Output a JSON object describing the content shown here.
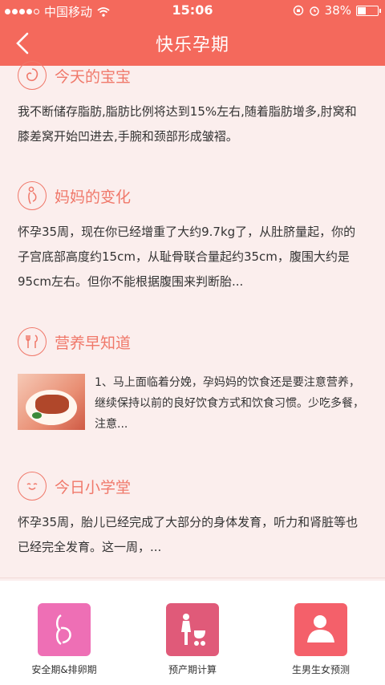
{
  "status": {
    "carrier": "中国移动",
    "time": "15:06",
    "battery": "38%"
  },
  "nav": {
    "title": "快乐孕期"
  },
  "sections": {
    "baby": {
      "title": "今天的宝宝",
      "text": "我不断储存脂肪,脂肪比例将达到15%左右,随着脂肪增多,肘窝和膝差窝开始凹进去,手腕和颈部形成皱褶。"
    },
    "mother": {
      "title": "妈妈的变化",
      "text": "怀孕35周，现在你已经增重了大约9.7kg了，从肚脐量起，你的子宫底部高度约15cm，从耻骨联合量起约35cm，腹围大约是95cm左右。但你不能根据腹围来判断胎..."
    },
    "nutrition": {
      "title": "营养早知道",
      "text": "1、马上面临着分娩，孕妈妈的饮食还是要注意营养，继续保持以前的良好饮食方式和饮食习惯。少吃多餐，注意..."
    },
    "school": {
      "title": "今日小学堂",
      "text": "怀孕35周，胎儿已经完成了大部分的身体发育，听力和肾脏等也已经完全发育。这一周，..."
    }
  },
  "tabs": [
    {
      "label": "安全期&排卵期",
      "color": "#ee6fb5"
    },
    {
      "label": "预产期计算",
      "color": "#e05a79"
    },
    {
      "label": "生男生女预测",
      "color": "#f4606a"
    }
  ],
  "colors": {
    "accent": "#f4695c",
    "section_title": "#f0786a"
  }
}
